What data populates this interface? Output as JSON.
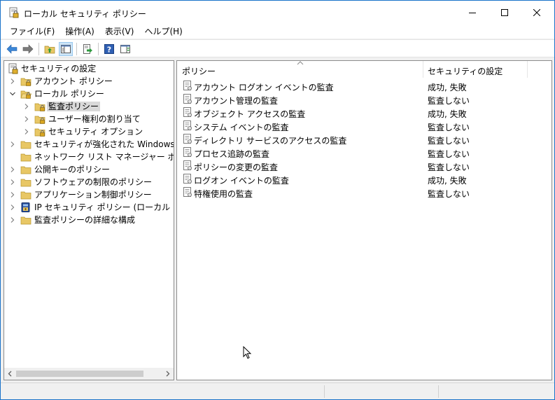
{
  "window": {
    "title": "ローカル セキュリティ ポリシー",
    "icon": "security-policy-icon"
  },
  "menu": [
    {
      "label": "ファイル(F)"
    },
    {
      "label": "操作(A)"
    },
    {
      "label": "表示(V)"
    },
    {
      "label": "ヘルプ(H)"
    }
  ],
  "toolbar": [
    "back-arrow-icon",
    "forward-arrow-icon",
    "up-folder-icon",
    "show-hide-tree-icon",
    "export-list-icon",
    "help-icon",
    "properties-pane-icon"
  ],
  "tree": {
    "root": "セキュリティの設定",
    "items": [
      {
        "label": "アカウント ポリシー",
        "level": 1,
        "expander": "collapsed",
        "icon": "folder-lock-icon"
      },
      {
        "label": "ローカル ポリシー",
        "level": 1,
        "expander": "expanded",
        "icon": "folder-lock-open-icon"
      },
      {
        "label": "監査ポリシー",
        "level": 2,
        "expander": "collapsed",
        "icon": "folder-lock-icon",
        "selected": true
      },
      {
        "label": "ユーザー権利の割り当て",
        "level": 2,
        "expander": "collapsed",
        "icon": "folder-lock-icon"
      },
      {
        "label": "セキュリティ オプション",
        "level": 2,
        "expander": "collapsed",
        "icon": "folder-lock-icon"
      },
      {
        "label": "セキュリティが強化された Windows ファイア",
        "level": 1,
        "expander": "collapsed",
        "icon": "folder-icon"
      },
      {
        "label": "ネットワーク リスト マネージャー ポリシー",
        "level": 1,
        "expander": "none",
        "icon": "folder-icon"
      },
      {
        "label": "公開キーのポリシー",
        "level": 1,
        "expander": "collapsed",
        "icon": "folder-icon"
      },
      {
        "label": "ソフトウェアの制限のポリシー",
        "level": 1,
        "expander": "collapsed",
        "icon": "folder-icon"
      },
      {
        "label": "アプリケーション制御ポリシー",
        "level": 1,
        "expander": "collapsed",
        "icon": "folder-icon"
      },
      {
        "label": "IP セキュリティ ポリシー (ローカル コンピュータ",
        "level": 1,
        "expander": "collapsed",
        "icon": "ip-security-icon"
      },
      {
        "label": "監査ポリシーの詳細な構成",
        "level": 1,
        "expander": "collapsed",
        "icon": "folder-icon"
      }
    ]
  },
  "list": {
    "columns": [
      "ポリシー",
      "セキュリティの設定"
    ],
    "rows": [
      {
        "name": "アカウント ログオン イベントの監査",
        "value": "成功, 失敗"
      },
      {
        "name": "アカウント管理の監査",
        "value": "監査しない"
      },
      {
        "name": "オブジェクト アクセスの監査",
        "value": "成功, 失敗"
      },
      {
        "name": "システム イベントの監査",
        "value": "監査しない"
      },
      {
        "name": "ディレクトリ サービスのアクセスの監査",
        "value": "監査しない"
      },
      {
        "name": "プロセス追跡の監査",
        "value": "監査しない"
      },
      {
        "name": "ポリシーの変更の監査",
        "value": "監査しない"
      },
      {
        "name": "ログオン イベントの監査",
        "value": "成功, 失敗"
      },
      {
        "name": "特権使用の監査",
        "value": "監査しない"
      }
    ]
  },
  "colors": {
    "window_border": "#1a73c9",
    "selection": "#d9d9d9",
    "folder": "#e8c765"
  }
}
